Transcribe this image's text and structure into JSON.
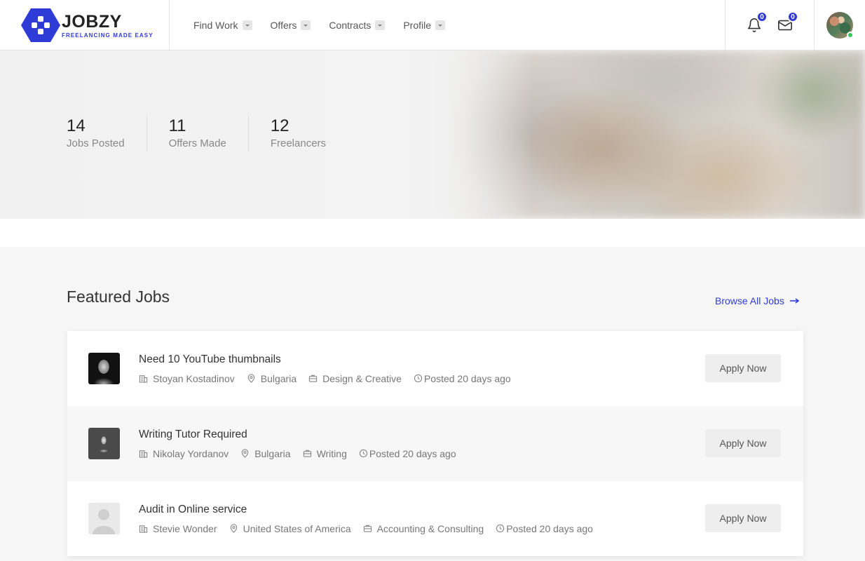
{
  "brand": {
    "name": "JOBZY",
    "tagline": "FREELANCING MADE EASY",
    "accent_color": "#2f3bd6"
  },
  "nav": {
    "items": [
      {
        "label": "Find Work"
      },
      {
        "label": "Offers"
      },
      {
        "label": "Contracts"
      },
      {
        "label": "Profile"
      }
    ]
  },
  "header_icons": {
    "notifications": {
      "icon": "bell-icon",
      "count": "0"
    },
    "messages": {
      "icon": "mail-icon",
      "count": "0"
    }
  },
  "stats": [
    {
      "value": "14",
      "label": "Jobs Posted"
    },
    {
      "value": "11",
      "label": "Offers Made"
    },
    {
      "value": "12",
      "label": "Freelancers"
    }
  ],
  "featured": {
    "title": "Featured Jobs",
    "browse_label": "Browse All Jobs",
    "apply_label": "Apply Now",
    "jobs": [
      {
        "title": "Need 10 YouTube thumbnails",
        "employer": "Stoyan Kostadinov",
        "location": "Bulgaria",
        "category": "Design & Creative",
        "posted": "Posted 20 days ago"
      },
      {
        "title": "Writing Tutor Required",
        "employer": "Nikolay Yordanov",
        "location": "Bulgaria",
        "category": "Writing",
        "posted": "Posted 20 days ago"
      },
      {
        "title": "Audit in Online service",
        "employer": "Stevie Wonder",
        "location": "United States of America",
        "category": "Accounting & Consulting",
        "posted": "Posted 20 days ago"
      }
    ]
  }
}
